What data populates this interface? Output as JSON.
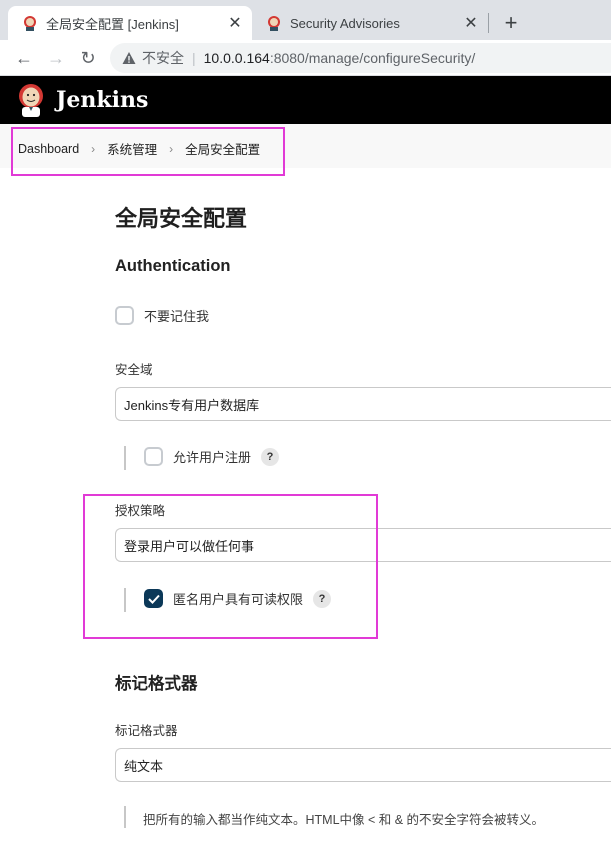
{
  "browser": {
    "tabs": [
      {
        "title": "全局安全配置 [Jenkins]",
        "close": "✕",
        "favicon": "jenkins-favicon-icon"
      },
      {
        "title": "Security Advisories",
        "close": "✕",
        "favicon": "jenkins-favicon-icon"
      }
    ],
    "new_tab": "+",
    "nav": {
      "back": "←",
      "forward": "→",
      "reload": "↻"
    },
    "address": {
      "insecure_label": "不安全",
      "separator": "|",
      "host": "10.0.0.164",
      "path": ":8080/manage/configureSecurity/"
    }
  },
  "header": {
    "title": "Jenkins"
  },
  "breadcrumb": {
    "items": [
      "Dashboard",
      "系统管理",
      "全局安全配置"
    ],
    "separator": "›"
  },
  "page": {
    "title": "全局安全配置",
    "authentication": {
      "heading": "Authentication",
      "disable_remember_me": {
        "label": "不要记住我",
        "checked": false
      },
      "security_realm": {
        "label": "安全域",
        "value": "Jenkins专有用户数据库",
        "allow_signup": {
          "label": "允许用户注册",
          "checked": false,
          "help": "?"
        }
      },
      "authorization": {
        "label": "授权策略",
        "value": "登录用户可以做任何事",
        "anonymous_read": {
          "label": "匿名用户具有可读权限",
          "checked": true,
          "help": "?"
        }
      }
    },
    "markup_formatter": {
      "heading": "标记格式器",
      "label": "标记格式器",
      "value": "纯文本",
      "description": "把所有的输入都当作纯文本。HTML中像 < 和 & 的不安全字符会被转义。"
    }
  },
  "colors": {
    "highlight": "#e13ad6",
    "checkbox_checked": "#0b3858",
    "header_bg": "#000000"
  }
}
